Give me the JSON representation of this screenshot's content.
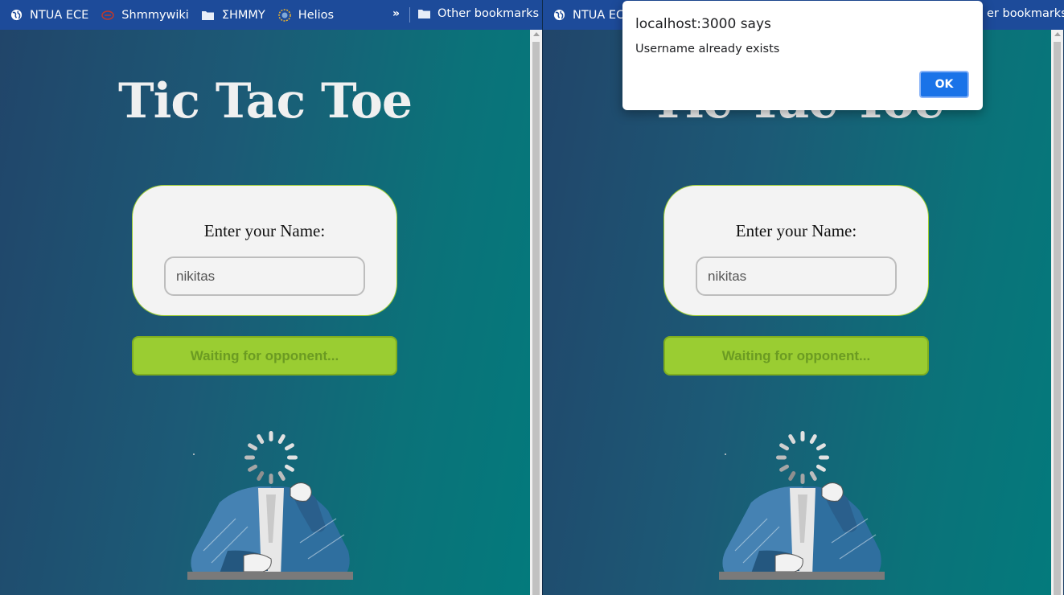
{
  "bookmarks": {
    "items": [
      {
        "label": "NTUA ECE",
        "icon": "globe-icon"
      },
      {
        "label": "Shmmywiki",
        "icon": "shmmywiki-icon"
      },
      {
        "label": "ΣΗΜΜΥ",
        "icon": "folder-icon"
      },
      {
        "label": "Helios",
        "icon": "helios-icon"
      }
    ],
    "overflow": "»",
    "other": "Other bookmarks",
    "right_first": "NTUA ECE",
    "right_other": "er bookmarks"
  },
  "page": {
    "title": "Tic Tac Toe",
    "name_label": "Enter your Name:",
    "name_value": "nikitas",
    "waiting_label": "Waiting for opponent..."
  },
  "dialog": {
    "title": "localhost:3000 says",
    "message": "Username already exists",
    "ok": "OK"
  },
  "colors": {
    "bookmarks_bar": "#1d4b9a",
    "accent_button": "#9acd32",
    "dialog_ok": "#1a73e8"
  }
}
